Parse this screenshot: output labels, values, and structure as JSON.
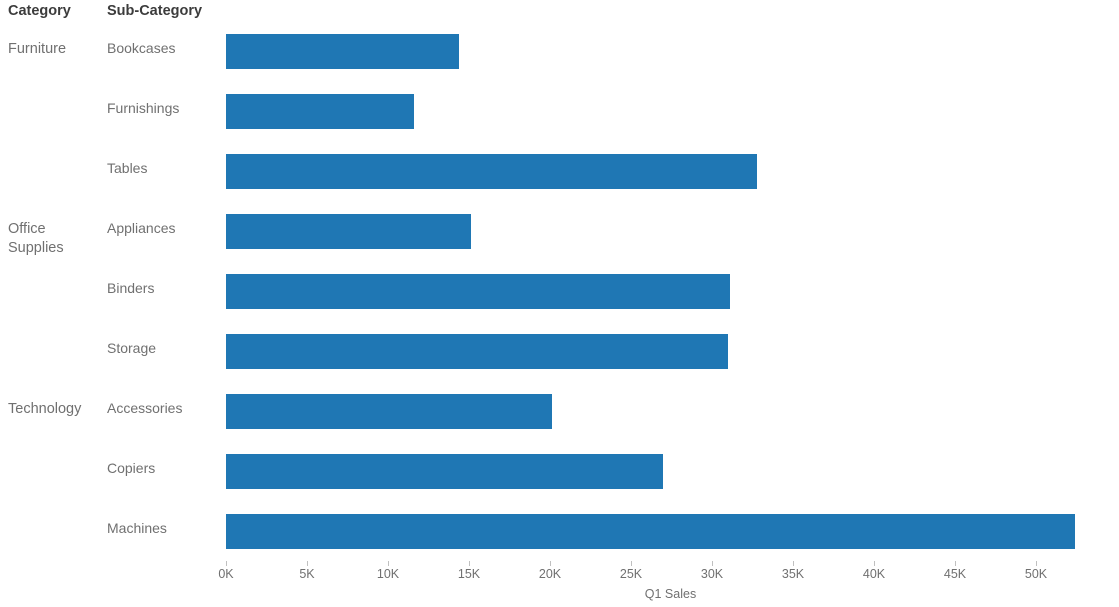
{
  "header": {
    "category_label": "Category",
    "subcategory_label": "Sub-Category"
  },
  "axis": {
    "title": "Q1 Sales",
    "tick_labels": [
      "0K",
      "5K",
      "10K",
      "15K",
      "20K",
      "25K",
      "30K",
      "35K",
      "40K",
      "45K",
      "50K"
    ],
    "tick_values": [
      0,
      5000,
      10000,
      15000,
      20000,
      25000,
      30000,
      35000,
      40000,
      45000,
      50000
    ]
  },
  "colors": {
    "bar": "#1f77b4",
    "header_text": "#3c3c3c",
    "label_text": "#707070",
    "tick": "#c0c0c0",
    "background": "#ffffff"
  },
  "rows": [
    {
      "category": "Furniture",
      "subcategory": "Bookcases",
      "value": 14400
    },
    {
      "category": "",
      "subcategory": "Furnishings",
      "value": 11600
    },
    {
      "category": "",
      "subcategory": "Tables",
      "value": 32800
    },
    {
      "category": "Office Supplies",
      "subcategory": "Appliances",
      "value": 15100
    },
    {
      "category": "",
      "subcategory": "Binders",
      "value": 31100
    },
    {
      "category": "",
      "subcategory": "Storage",
      "value": 31000
    },
    {
      "category": "Technology",
      "subcategory": "Accessories",
      "value": 20100
    },
    {
      "category": "",
      "subcategory": "Copiers",
      "value": 27000
    },
    {
      "category": "",
      "subcategory": "Machines",
      "value": 52400
    }
  ],
  "chart_data": {
    "type": "bar",
    "orientation": "horizontal",
    "title": "",
    "xlabel": "Q1 Sales",
    "ylabel": "Sub-Category",
    "xlim": [
      0,
      52400
    ],
    "grid": false,
    "legend": "none",
    "categories": [
      "Bookcases",
      "Furnishings",
      "Tables",
      "Appliances",
      "Binders",
      "Storage",
      "Accessories",
      "Copiers",
      "Machines"
    ],
    "groups": [
      "Furniture",
      "Furniture",
      "Furniture",
      "Office Supplies",
      "Office Supplies",
      "Office Supplies",
      "Technology",
      "Technology",
      "Technology"
    ],
    "values": [
      14400,
      11600,
      32800,
      15100,
      31100,
      31000,
      20100,
      27000,
      52400
    ],
    "tick_labels": [
      "0K",
      "5K",
      "10K",
      "15K",
      "20K",
      "25K",
      "30K",
      "35K",
      "40K",
      "45K",
      "50K"
    ],
    "color": "#1f77b4"
  }
}
